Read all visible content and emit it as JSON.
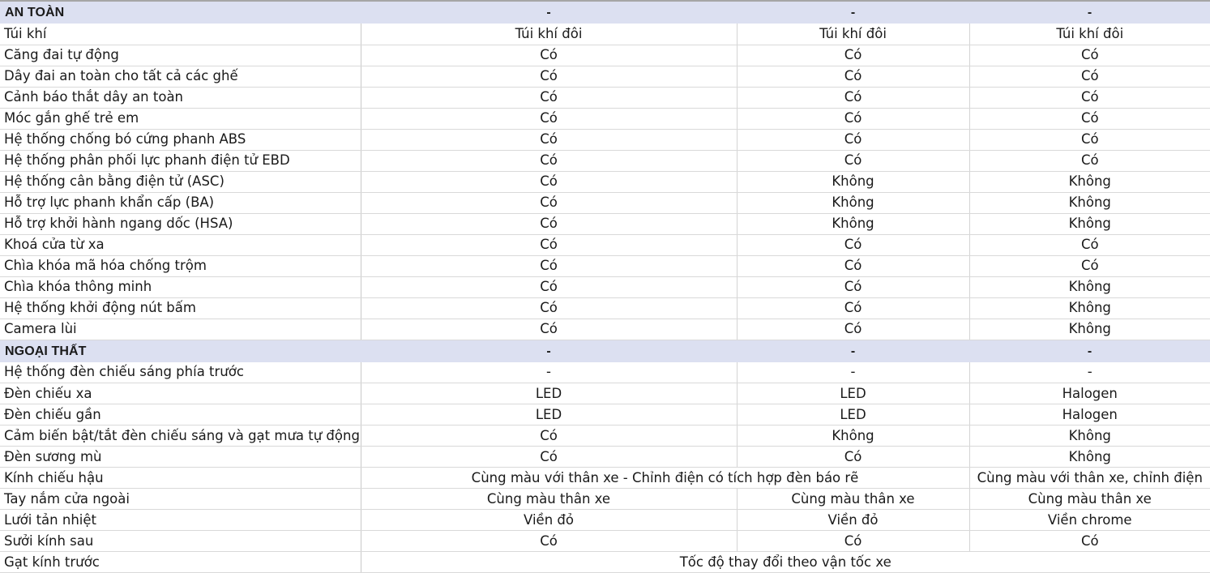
{
  "document": {
    "type": "vehicle-specification-comparison-table",
    "column_count": 4
  },
  "sections": [
    {
      "id": "an-toan",
      "title": "AN TOÀN",
      "header_values": [
        "-",
        "-",
        "-"
      ],
      "rows": [
        {
          "label": "Túi khí",
          "values": [
            "Túi khí đôi",
            "Túi khí đôi",
            "Túi khí đôi"
          ]
        },
        {
          "label": "Căng đai tự động",
          "values": [
            "Có",
            "Có",
            "Có"
          ]
        },
        {
          "label": "Dây đai an toàn cho tất cả các ghế",
          "values": [
            "Có",
            "Có",
            "Có"
          ]
        },
        {
          "label": "Cảnh báo thắt dây an toàn",
          "values": [
            "Có",
            "Có",
            "Có"
          ]
        },
        {
          "label": "Móc gắn ghế trẻ em",
          "values": [
            "Có",
            "Có",
            "Có"
          ]
        },
        {
          "label": "Hệ thống chống bó cứng phanh ABS",
          "values": [
            "Có",
            "Có",
            "Có"
          ]
        },
        {
          "label": "Hệ thống phân phối lực phanh điện tử EBD",
          "values": [
            "Có",
            "Có",
            "Có"
          ]
        },
        {
          "label": "Hệ thống cân bằng điện tử (ASC)",
          "values": [
            "Có",
            "Không",
            "Không"
          ]
        },
        {
          "label": "Hỗ trợ lực phanh khẩn cấp (BA)",
          "values": [
            "Có",
            "Không",
            "Không"
          ]
        },
        {
          "label": "Hỗ trợ khởi hành ngang dốc (HSA)",
          "values": [
            "Có",
            "Không",
            "Không"
          ]
        },
        {
          "label": "Khoá cửa từ xa",
          "values": [
            "Có",
            "Có",
            "Có"
          ]
        },
        {
          "label": "Chìa khóa mã hóa chống trộm",
          "values": [
            "Có",
            "Có",
            "Có"
          ]
        },
        {
          "label": "Chìa khóa thông minh",
          "values": [
            "Có",
            "Có",
            "Không"
          ]
        },
        {
          "label": "Hệ thống khởi động nút bấm",
          "values": [
            "Có",
            "Có",
            "Không"
          ]
        },
        {
          "label": "Camera lùi",
          "values": [
            "Có",
            "Có",
            "Không"
          ]
        }
      ]
    },
    {
      "id": "ngoai-that",
      "title": "NGOẠI THẤT",
      "header_values": [
        "-",
        "-",
        "-"
      ],
      "rows": [
        {
          "label": "Hệ thống đèn chiếu sáng phía trước",
          "values": [
            "-",
            "-",
            "-"
          ]
        },
        {
          "label": "Đèn chiếu xa",
          "values": [
            "LED",
            "LED",
            "Halogen"
          ]
        },
        {
          "label": "Đèn chiếu gần",
          "values": [
            "LED",
            "LED",
            "Halogen"
          ]
        },
        {
          "label": "Cảm biến bật/tắt đèn chiếu sáng và gạt mưa tự động",
          "values": [
            "Có",
            "Không",
            "Không"
          ]
        },
        {
          "label": "Đèn sương mù",
          "values": [
            "Có",
            "Có",
            "Không"
          ]
        },
        {
          "label": "Kính chiếu hậu",
          "merge": "first-two",
          "values": [
            "Cùng màu với thân xe - Chỉnh điện có tích hợp đèn báo rẽ",
            "Cùng màu với thân xe, chỉnh điện"
          ]
        },
        {
          "label": "Tay nắm cửa ngoài",
          "values": [
            "Cùng màu thân xe",
            "Cùng màu thân xe",
            "Cùng màu thân xe"
          ]
        },
        {
          "label": "Lưới tản nhiệt",
          "values": [
            "Viền đỏ",
            "Viền đỏ",
            "Viền chrome"
          ]
        },
        {
          "label": "Sưởi kính sau",
          "values": [
            "Có",
            "Có",
            "Có"
          ]
        },
        {
          "label": "Gạt kính trước",
          "merge": "all",
          "values": [
            "Tốc độ thay đổi theo vận tốc xe"
          ]
        }
      ]
    }
  ],
  "colors": {
    "section_header_background": "#dce0f1",
    "grid_line": "#d4d4d4",
    "text": "#1a1a1a",
    "top_border": "#a6a6a6"
  }
}
